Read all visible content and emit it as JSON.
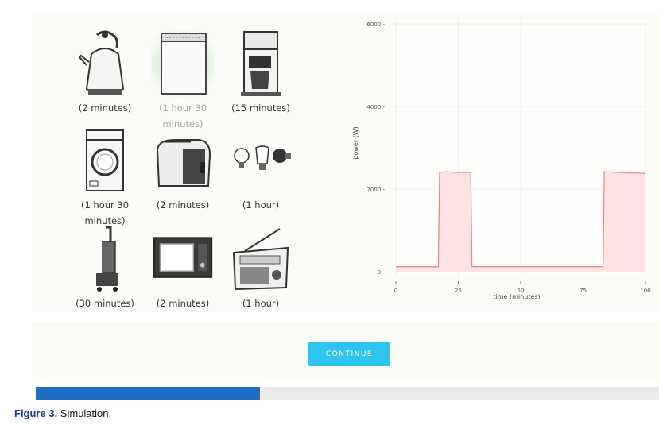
{
  "appliances": [
    {
      "name": "kettle",
      "duration": "(2 minutes)",
      "selected": false
    },
    {
      "name": "dishwasher",
      "duration": "(1 hour 30 minutes)",
      "selected": true
    },
    {
      "name": "coffee-maker",
      "duration": "(15 minutes)",
      "selected": false
    },
    {
      "name": "washing-machine",
      "duration": "(1 hour 30 minutes)",
      "selected": false
    },
    {
      "name": "toaster",
      "duration": "(2 minutes)",
      "selected": false
    },
    {
      "name": "light-bulbs",
      "duration": "(1 hour)",
      "selected": false
    },
    {
      "name": "vacuum-cleaner",
      "duration": "(30 minutes)",
      "selected": false
    },
    {
      "name": "microwave",
      "duration": "(2 minutes)",
      "selected": false
    },
    {
      "name": "radio",
      "duration": "(1 hour)",
      "selected": false
    }
  ],
  "continue_label": "CONTINUE",
  "progress": 0.36,
  "caption": {
    "label": "Figure 3.",
    "text": " Simulation."
  },
  "colors": {
    "accent": "#2ec4ee",
    "progress": "#1f6fc1",
    "series_line": "#f08080",
    "series_fill": "#fde3e3"
  },
  "chart_data": {
    "type": "area",
    "xlabel": "time (minutes)",
    "ylabel": "power (W)",
    "xlim": [
      0,
      100
    ],
    "ylim": [
      0,
      6000
    ],
    "xticks": [
      0,
      25,
      50,
      75,
      100
    ],
    "yticks": [
      0,
      2000,
      4000,
      6000
    ],
    "grid": true,
    "series": [
      {
        "x": [
          0,
          17,
          17.5,
          20,
          25,
          30,
          30.5,
          70,
          75,
          83,
          83.5,
          90,
          95,
          100
        ],
        "y": [
          120,
          120,
          2400,
          2420,
          2400,
          2400,
          120,
          120,
          120,
          120,
          2420,
          2400,
          2390,
          2380
        ]
      }
    ]
  }
}
